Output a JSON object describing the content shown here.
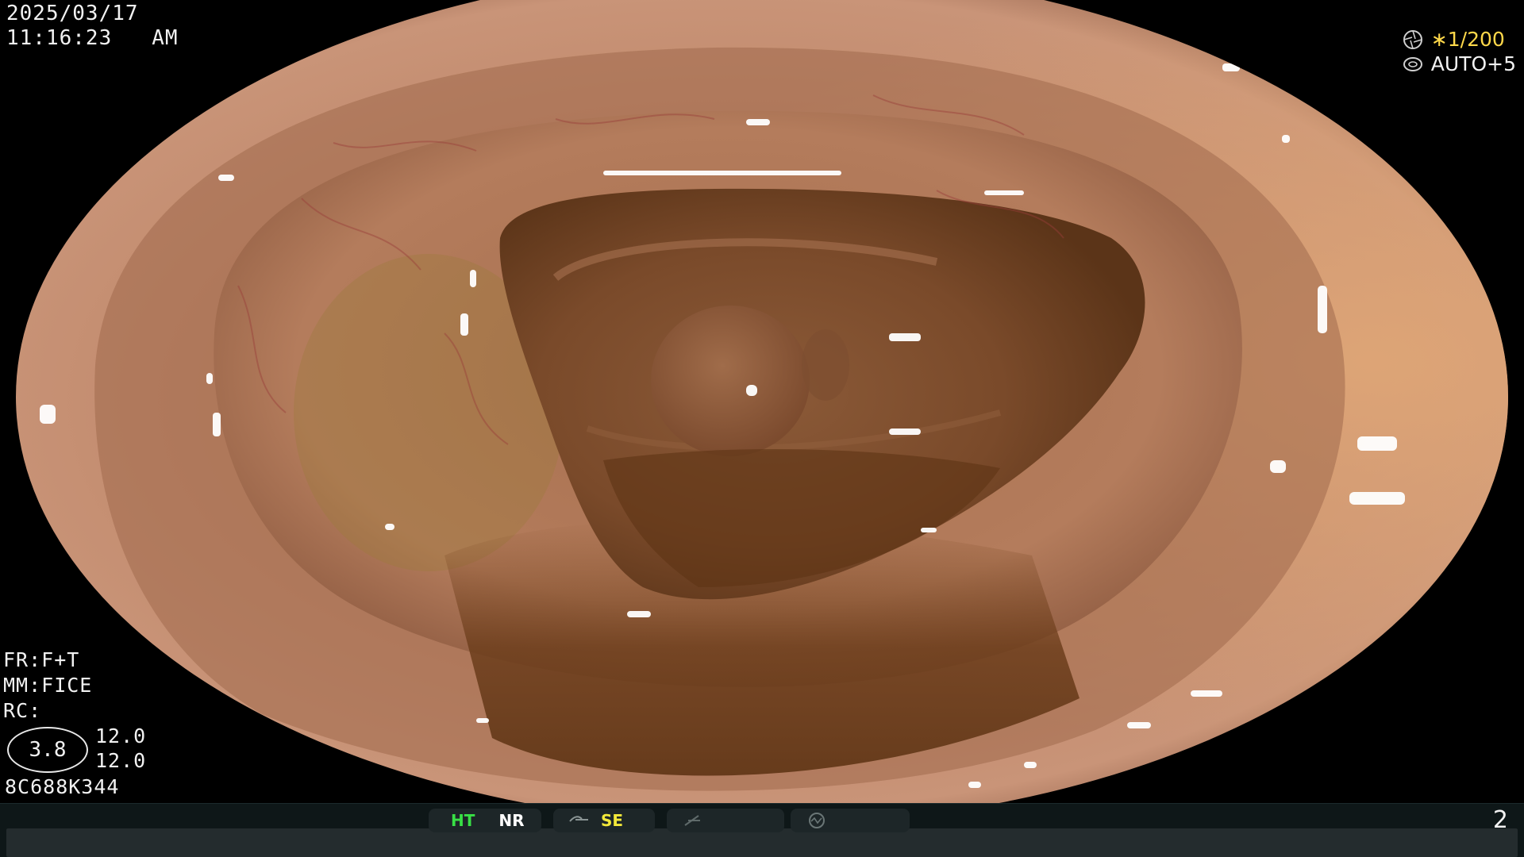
{
  "overlay": {
    "date": "2025/03/17",
    "time": "11:16:23",
    "meridiem": "AM",
    "shutter": "∗1/200",
    "auto_level": "AUTO+5",
    "fr": "FR:F+T",
    "mm": "MM:FICE",
    "rc": "RC:",
    "zoom": "3.8",
    "value_a": "12.0",
    "value_b": "12.0",
    "serial": "8C688K344",
    "page_number": "2"
  },
  "status_bar": {
    "ht": "HT",
    "nr": "NR",
    "se": "SE"
  },
  "colors": {
    "ht": "#38e045",
    "se": "#f3e83a",
    "shutter": "#ffd84a",
    "tissue": "#b27d5e",
    "lumen": "#6b3f20"
  },
  "icons": [
    "iris-icon",
    "lens-icon",
    "curve-icon",
    "slash-icon",
    "ring-icon"
  ]
}
